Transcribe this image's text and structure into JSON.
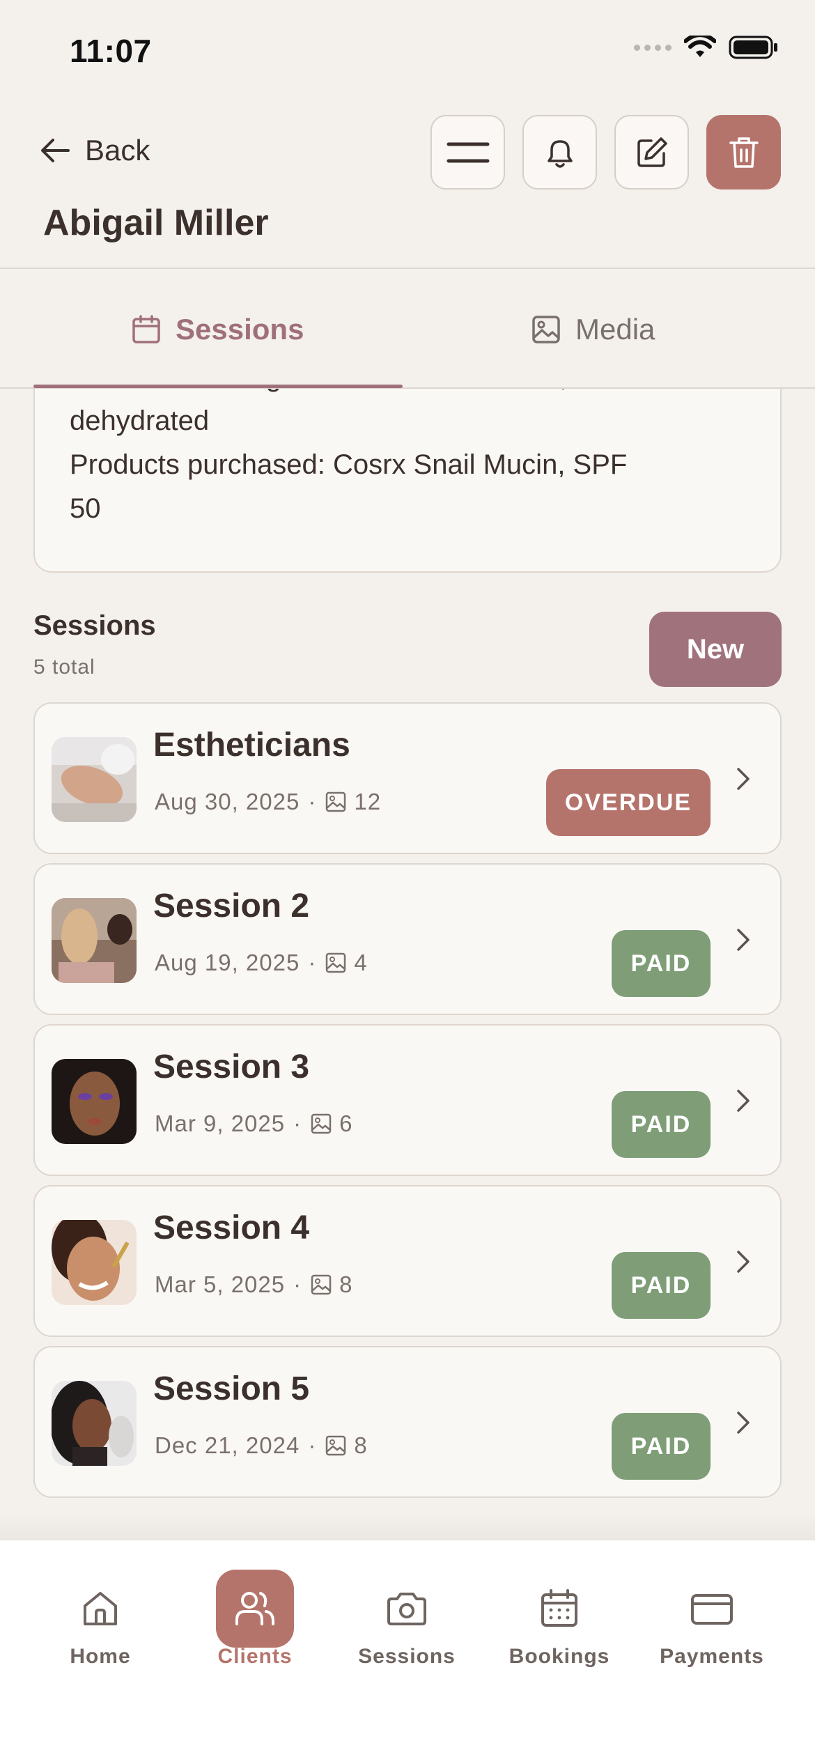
{
  "status_bar": {
    "time": "11:07"
  },
  "header": {
    "back_label": "Back",
    "client_name": "Abigail Miller"
  },
  "tabs": [
    {
      "label": "Sessions",
      "icon": "calendar-icon",
      "active": true
    },
    {
      "label": "Media",
      "icon": "image-icon",
      "active": false
    }
  ],
  "notes": {
    "line1": "Notes: Works night shifts — affects skin, often",
    "line2": "dehydrated",
    "line3": "Products purchased: Cosrx Snail Mucin, SPF",
    "line4": "50"
  },
  "sessions_section": {
    "title": "Sessions",
    "count": "5 total",
    "new_label": "New"
  },
  "sessions": [
    {
      "title": "Estheticians",
      "date": "Aug 30, 2025",
      "photos": "12",
      "status": "OVERDUE"
    },
    {
      "title": "Session 2",
      "date": "Aug 19, 2025",
      "photos": "4",
      "status": "PAID"
    },
    {
      "title": "Session 3",
      "date": "Mar 9, 2025",
      "photos": "6",
      "status": "PAID"
    },
    {
      "title": "Session 4",
      "date": "Mar 5, 2025",
      "photos": "8",
      "status": "PAID"
    },
    {
      "title": "Session 5",
      "date": "Dec 21, 2024",
      "photos": "8",
      "status": "PAID"
    }
  ],
  "nav": [
    {
      "label": "Home",
      "icon": "home-icon"
    },
    {
      "label": "Clients",
      "icon": "users-icon",
      "active": true
    },
    {
      "label": "Sessions",
      "icon": "camera-icon"
    },
    {
      "label": "Bookings",
      "icon": "calendar-icon"
    },
    {
      "label": "Payments",
      "icon": "card-icon"
    }
  ],
  "colors": {
    "accent": "#a0727c",
    "danger": "#b5746b",
    "paid": "#7f9e78",
    "background": "#f4f1ed"
  }
}
